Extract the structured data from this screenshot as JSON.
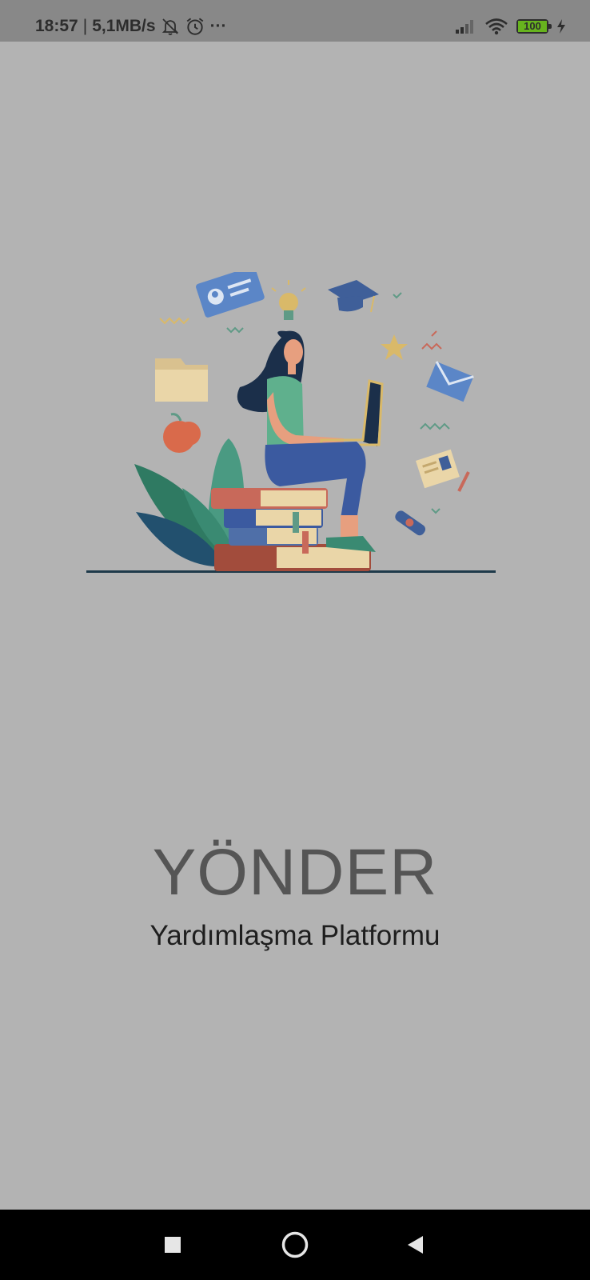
{
  "status_bar": {
    "time": "18:57",
    "separator": "|",
    "network_speed": "5,1MB/s",
    "more": "···",
    "battery_level": "100",
    "icons": [
      "do-not-disturb-icon",
      "alarm-icon",
      "signal-icon",
      "wifi-icon",
      "battery-icon",
      "charging-icon"
    ]
  },
  "splash": {
    "title": "YÖNDER",
    "subtitle": "Yardımlaşma Platformu"
  },
  "navigation": {
    "icons": [
      "recents-square-icon",
      "home-circle-icon",
      "back-triangle-icon"
    ]
  },
  "colors": {
    "background": "#b3b3b3",
    "status_bar": "#888888",
    "title": "#555555",
    "subtitle": "#1e1e1e",
    "nav_bar": "#000000",
    "battery": "#67b31e"
  }
}
